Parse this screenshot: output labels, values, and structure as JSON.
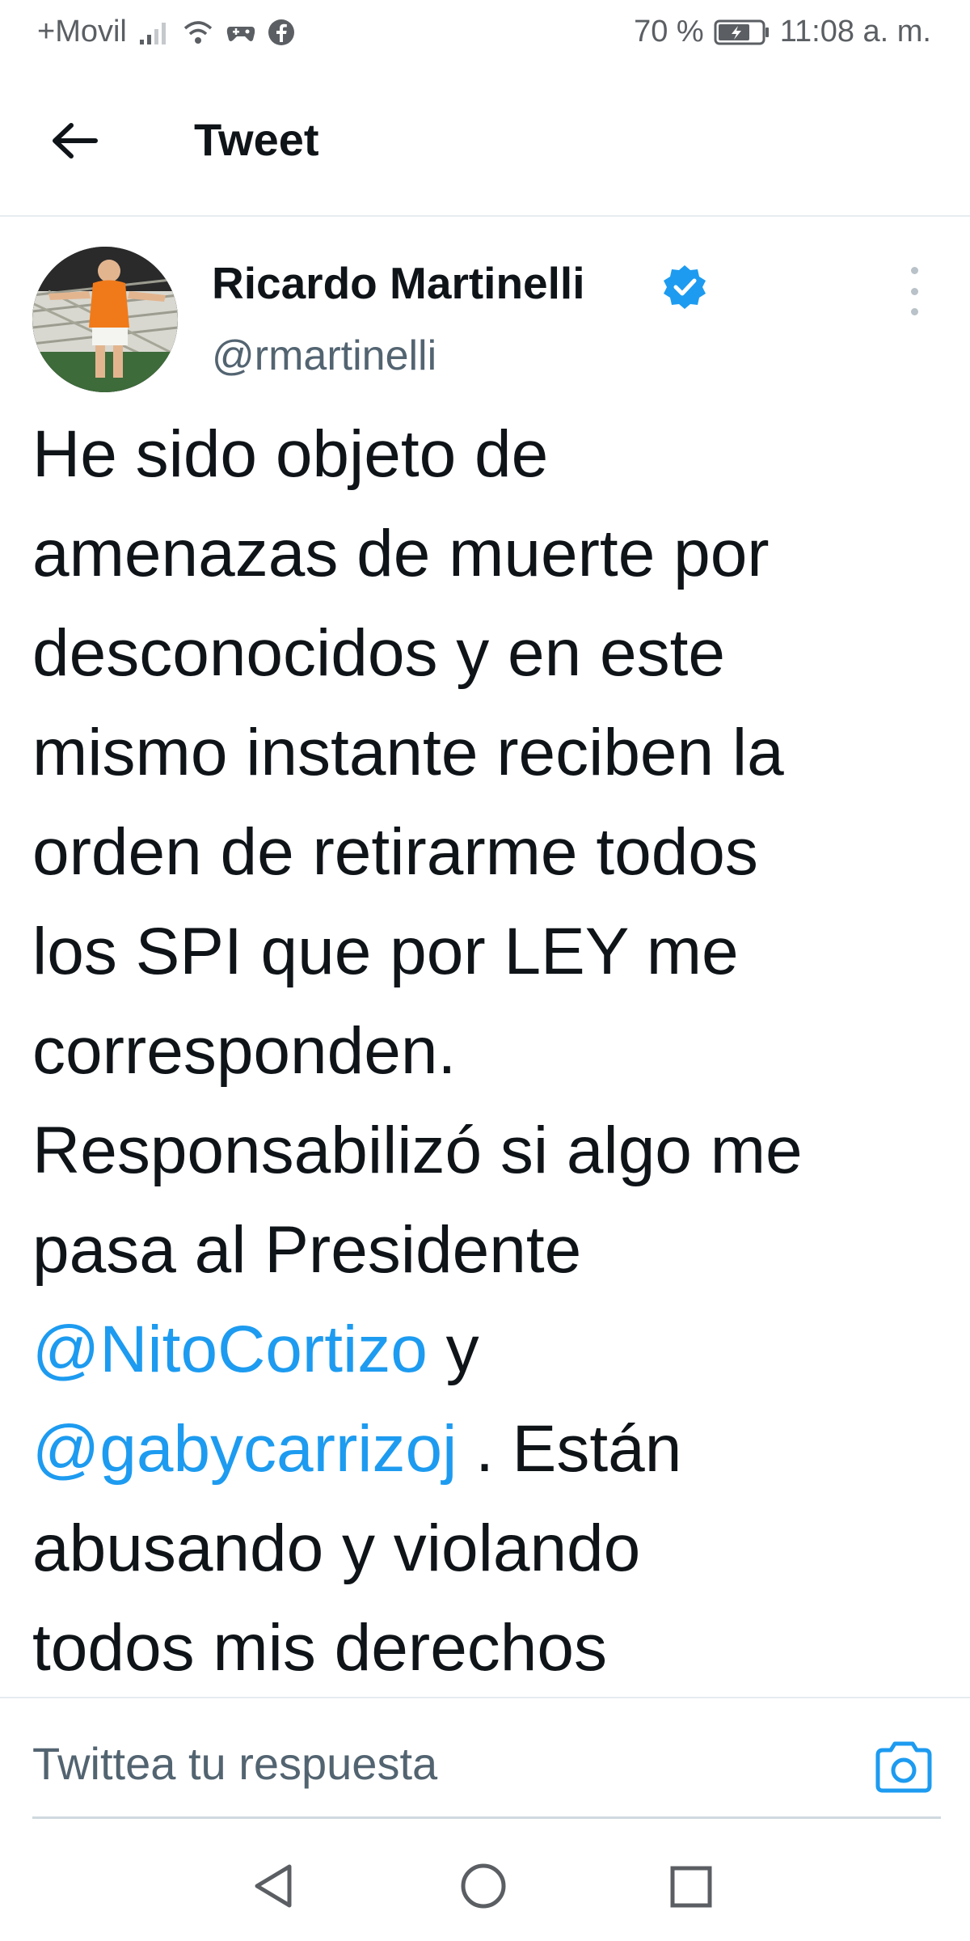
{
  "status_bar": {
    "carrier": "+Movil",
    "battery_percent": "70 %",
    "time": "11:08 a. m.",
    "icons": [
      "signal-icon",
      "wifi-icon",
      "game-controller-icon",
      "facebook-icon",
      "battery-icon"
    ]
  },
  "header": {
    "title": "Tweet",
    "back_icon": "back-arrow-icon"
  },
  "tweet": {
    "author_name": "Ricardo Martinelli",
    "author_handle": "@rmartinelli",
    "verified": true,
    "text_lines": [
      "He sido objeto de",
      "amenazas de muerte por",
      "desconocidos y en este",
      "mismo instante reciben la",
      "orden de retirarme todos",
      "los SPI que por LEY me",
      "corresponden.",
      "Responsabilizó si algo me",
      "pasa al Presidente"
    ],
    "mention_1": "@NitoCortizo",
    "after_mention_1": " y",
    "mention_2": "@gabycarrizoj",
    "after_mention_2": " . Están",
    "text_lines_end": [
      "abusando y violando",
      "todos mis derechos"
    ]
  },
  "reply": {
    "placeholder": "Twittea tu respuesta",
    "camera_icon": "camera-icon"
  },
  "navigation": {
    "icons": [
      "nav-back-icon",
      "nav-home-icon",
      "nav-recent-apps-icon"
    ]
  },
  "colors": {
    "accent": "#1d9bf0",
    "text": "#0f1419",
    "secondary_text": "#536471"
  }
}
